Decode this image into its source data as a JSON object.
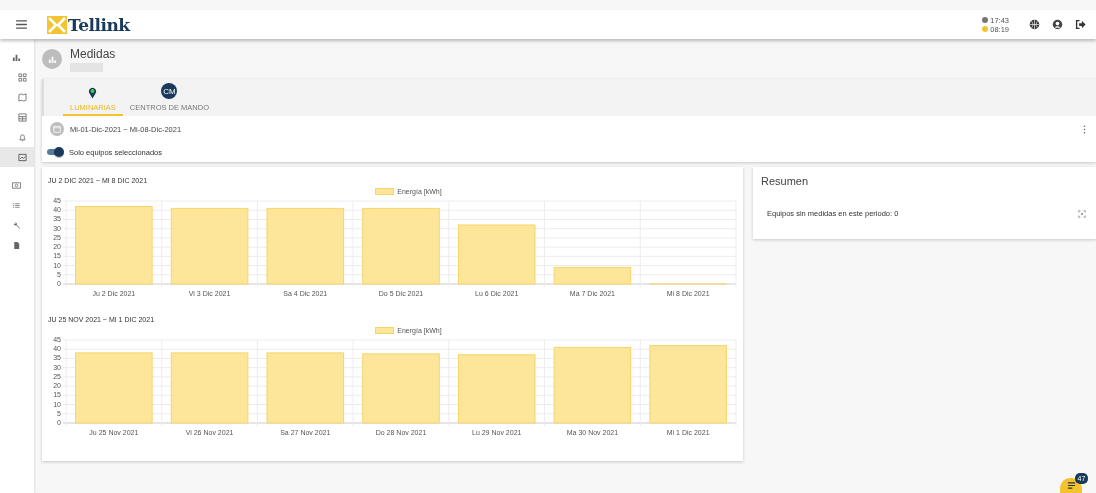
{
  "header": {
    "logo": "Tellink",
    "times": [
      {
        "value": "17:43",
        "color": "#757575"
      },
      {
        "value": "08:19",
        "color": "#f4c430"
      }
    ]
  },
  "sidebar": {
    "items": [
      {
        "selected": false
      },
      {
        "selected": false
      },
      {
        "selected": false
      },
      {
        "selected": false
      },
      {
        "selected": false
      },
      {
        "selected": true
      },
      {
        "selected": false
      },
      {
        "selected": false
      },
      {
        "selected": false
      },
      {
        "selected": false
      }
    ]
  },
  "page": {
    "title": "Medidas"
  },
  "tabs": [
    {
      "label": "LUMINARIAS",
      "kind": "pin",
      "selected": true
    },
    {
      "label": "CENTROS DE MANDO",
      "kind": "initials",
      "initials": "CM",
      "selected": false
    }
  ],
  "period": {
    "range": "Mi-01-Dic-2021 ~ Mi-08-Dic-2021"
  },
  "toggle": {
    "label": "Solo equipos seleccionados",
    "on": true
  },
  "charts": [
    {
      "heading": "JU 2 DIC 2021 ~ MI 8 DIC 2021",
      "chart_data": {
        "type": "bar",
        "categories": [
          "Ju 2 Dic 2021",
          "Vi 3 Dic 2021",
          "Sa 4 Dic 2021",
          "Do 5 Dic 2021",
          "Lu 6 Dic 2021",
          "Ma 7 Dic 2021",
          "Mi 8 Dic 2021"
        ],
        "series": [
          {
            "name": "Energía [kWh]",
            "color": "#fde59a",
            "values": [
              42,
              41,
              41,
              41,
              32,
              9,
              0
            ]
          }
        ],
        "grid": true,
        "ylim": [
          0,
          45
        ],
        "yticks": [
          0,
          5,
          10,
          15,
          20,
          25,
          30,
          35,
          40,
          45
        ]
      }
    },
    {
      "heading": "JU 25 NOV 2021 ~ MI 1 DIC 2021",
      "chart_data": {
        "type": "bar",
        "categories": [
          "Ju 25 Nov 2021",
          "Vi 26 Nov 2021",
          "Sa 27 Nov 2021",
          "Do 28 Nov 2021",
          "Lu 29 Nov 2021",
          "Ma 30 Nov 2021",
          "Mi 1 Dic 2021"
        ],
        "series": [
          {
            "name": "Energía [kWh]",
            "color": "#fde59a",
            "values": [
              38,
              38,
              38,
              37.5,
              37,
              41,
              42
            ]
          }
        ],
        "grid": true,
        "ylim": [
          0,
          45
        ],
        "yticks": [
          0,
          5,
          10,
          15,
          20,
          25,
          30,
          35,
          40,
          45
        ]
      }
    }
  ],
  "summary": {
    "title": "Resumen",
    "text": "Equipos sin medidas en este periodo: 0"
  },
  "fab": {
    "badge": "47"
  }
}
